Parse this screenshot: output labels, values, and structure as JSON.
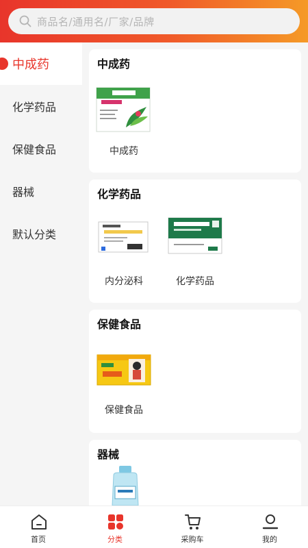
{
  "search": {
    "placeholder": "商品名/通用名/厂家/品牌"
  },
  "sidebar": {
    "items": [
      {
        "label": "中成药",
        "active": true
      },
      {
        "label": "化学药品",
        "active": false
      },
      {
        "label": "保健食品",
        "active": false
      },
      {
        "label": "器械",
        "active": false
      },
      {
        "label": "默认分类",
        "active": false
      }
    ]
  },
  "sections": [
    {
      "title": "中成药",
      "products": [
        {
          "label": "中成药"
        }
      ]
    },
    {
      "title": "化学药品",
      "products": [
        {
          "label": "内分泌科"
        },
        {
          "label": "化学药品"
        }
      ]
    },
    {
      "title": "保健食品",
      "products": [
        {
          "label": "保健食品"
        }
      ]
    },
    {
      "title": "器械",
      "products": [
        {
          "label": ""
        }
      ]
    }
  ],
  "tabbar": {
    "items": [
      {
        "label": "首页",
        "icon": "home-icon"
      },
      {
        "label": "分类",
        "icon": "category-icon",
        "active": true
      },
      {
        "label": "采购车",
        "icon": "cart-icon"
      },
      {
        "label": "我的",
        "icon": "profile-icon"
      }
    ]
  },
  "colors": {
    "accent": "#e8352b",
    "gradient_end": "#f59a27"
  }
}
